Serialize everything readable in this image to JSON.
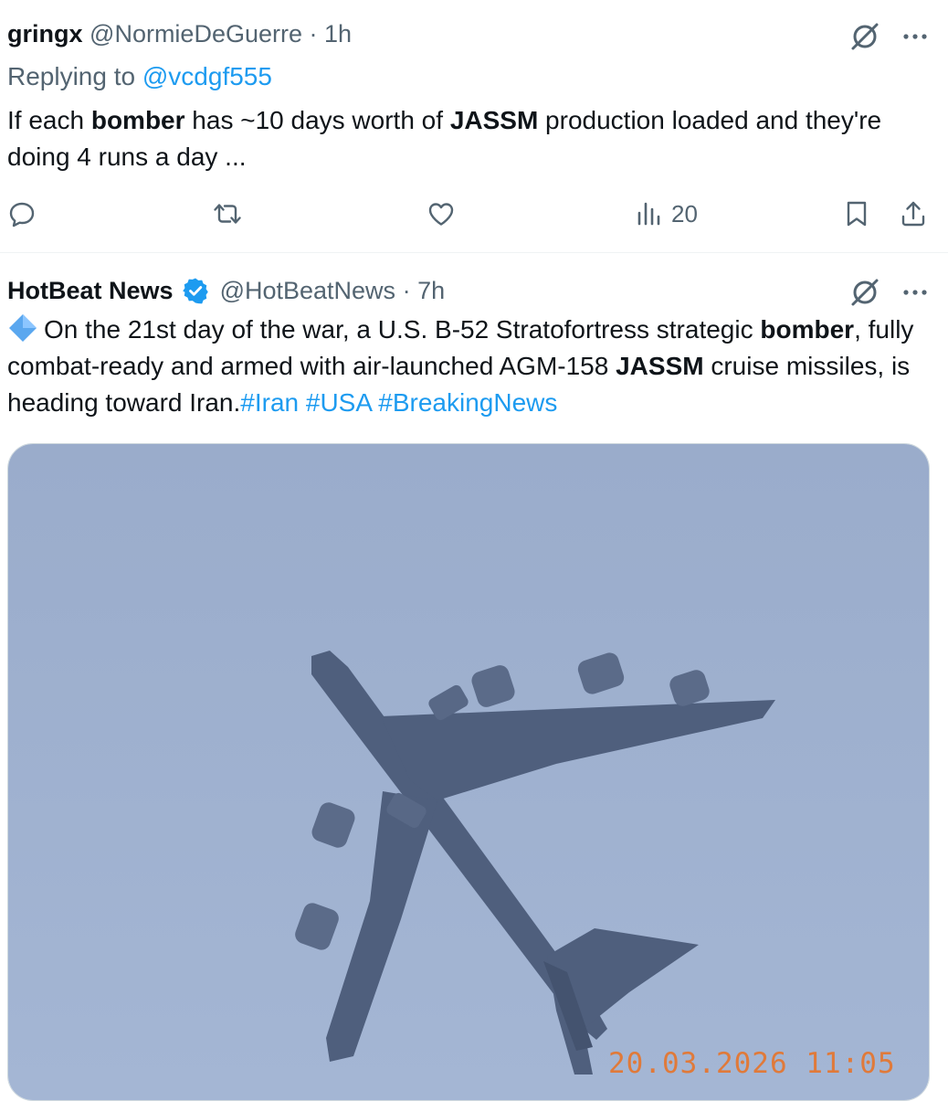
{
  "reply_post": {
    "display_name": "gringx",
    "handle": "@NormieDeGuerre",
    "separator": "·",
    "time": "1h",
    "replying_prefix": "Replying to",
    "replying_to": "@vcdgf555",
    "text": {
      "part1": "If each ",
      "bold1": "bomber",
      "part2": " has ~10 days worth of ",
      "bold2": "JASSM",
      "part3": " production loaded and they're doing 4 runs a day ..."
    },
    "actions": {
      "views_count": "20"
    }
  },
  "main_post": {
    "display_name": "HotBeat News",
    "handle": "@HotBeatNews",
    "separator": "·",
    "time": "7h",
    "text": {
      "part1": "On the 21st day of the war, a U.S. B-52 Stratofortress strategic ",
      "bold1": "bomber",
      "part2": ", fully combat-ready and armed with air-launched AGM-158 ",
      "bold2": "JASSM",
      "part3": " cruise missiles, is heading toward Iran.",
      "hashtag1": "#Iran",
      "hashtag2": "#USA",
      "hashtag3": "#BreakingNews"
    },
    "media": {
      "timestamp_overlay": "20.03.2026  11:05"
    }
  },
  "icons": [
    "grok-icon",
    "more-icon",
    "reply-icon",
    "repost-icon",
    "like-icon",
    "views-icon",
    "bookmark-icon",
    "share-icon",
    "verified-badge-icon",
    "blue-diamond-icon"
  ],
  "colors": {
    "link": "#1d9bf0",
    "secondary_text": "#536471",
    "primary_text": "#0f1419",
    "sky": "#9fb1cf",
    "aircraft": "#4a5a78",
    "timestamp": "#e07a3a"
  }
}
